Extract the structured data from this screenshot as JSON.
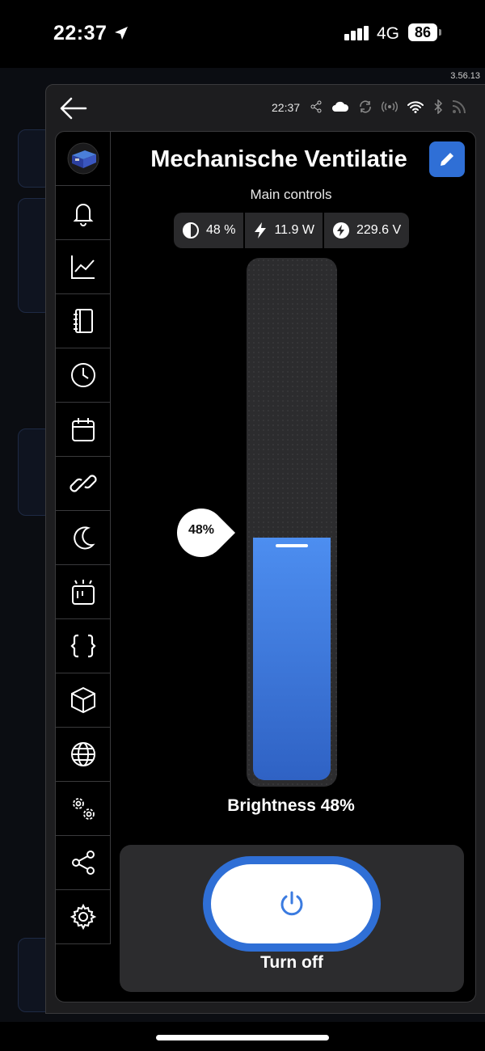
{
  "status_bar": {
    "time": "22:37",
    "network": "4G",
    "battery": "86"
  },
  "version": "3.56.13",
  "topbar": {
    "time": "22:37"
  },
  "device": {
    "title": "Mechanische Ventilatie",
    "subtitle": "Main controls",
    "chips": [
      {
        "icon": "contrast-icon",
        "value": "48 %"
      },
      {
        "icon": "bolt-icon",
        "value": "11.9 W"
      },
      {
        "icon": "voltage-icon",
        "value": "229.6 V"
      }
    ]
  },
  "slider": {
    "value_percent": 48,
    "bubble_label": "48%",
    "caption": "Brightness 48%"
  },
  "control": {
    "label": "Turn off"
  },
  "nav_icons": [
    "bell-icon",
    "chart-icon",
    "notebook-icon",
    "clock-icon",
    "calendar-icon",
    "link-icon",
    "moon-icon",
    "scene-icon",
    "code-icon",
    "cube-icon",
    "globe-icon",
    "gears-icon",
    "share-icon",
    "settings-icon"
  ],
  "colors": {
    "accent": "#2f6fd6",
    "fill_top": "#4d8ef0",
    "fill_bottom": "#2f62c4"
  }
}
